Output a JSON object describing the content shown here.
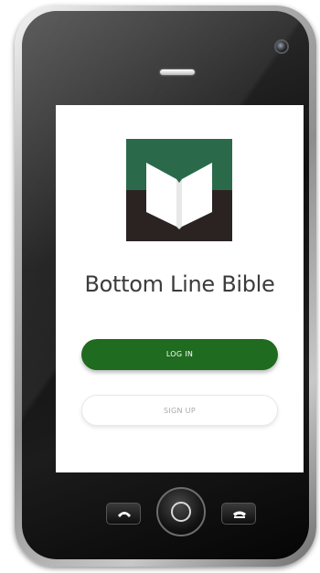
{
  "app": {
    "title": "Bottom Line Bible"
  },
  "actions": {
    "login_label": "LOG IN",
    "signup_label": "SIGN UP"
  },
  "colors": {
    "brand_green": "#1f6b1f",
    "logo_green": "#2a6a4a",
    "logo_dark": "#2b2322",
    "title_text": "#3c3c3c"
  },
  "icons": {
    "logo": "open-book-icon",
    "camera": "front-camera-icon",
    "speaker": "earpiece-speaker-icon",
    "call": "phone-call-icon",
    "hangup": "phone-hangup-icon",
    "home": "home-button-icon"
  }
}
